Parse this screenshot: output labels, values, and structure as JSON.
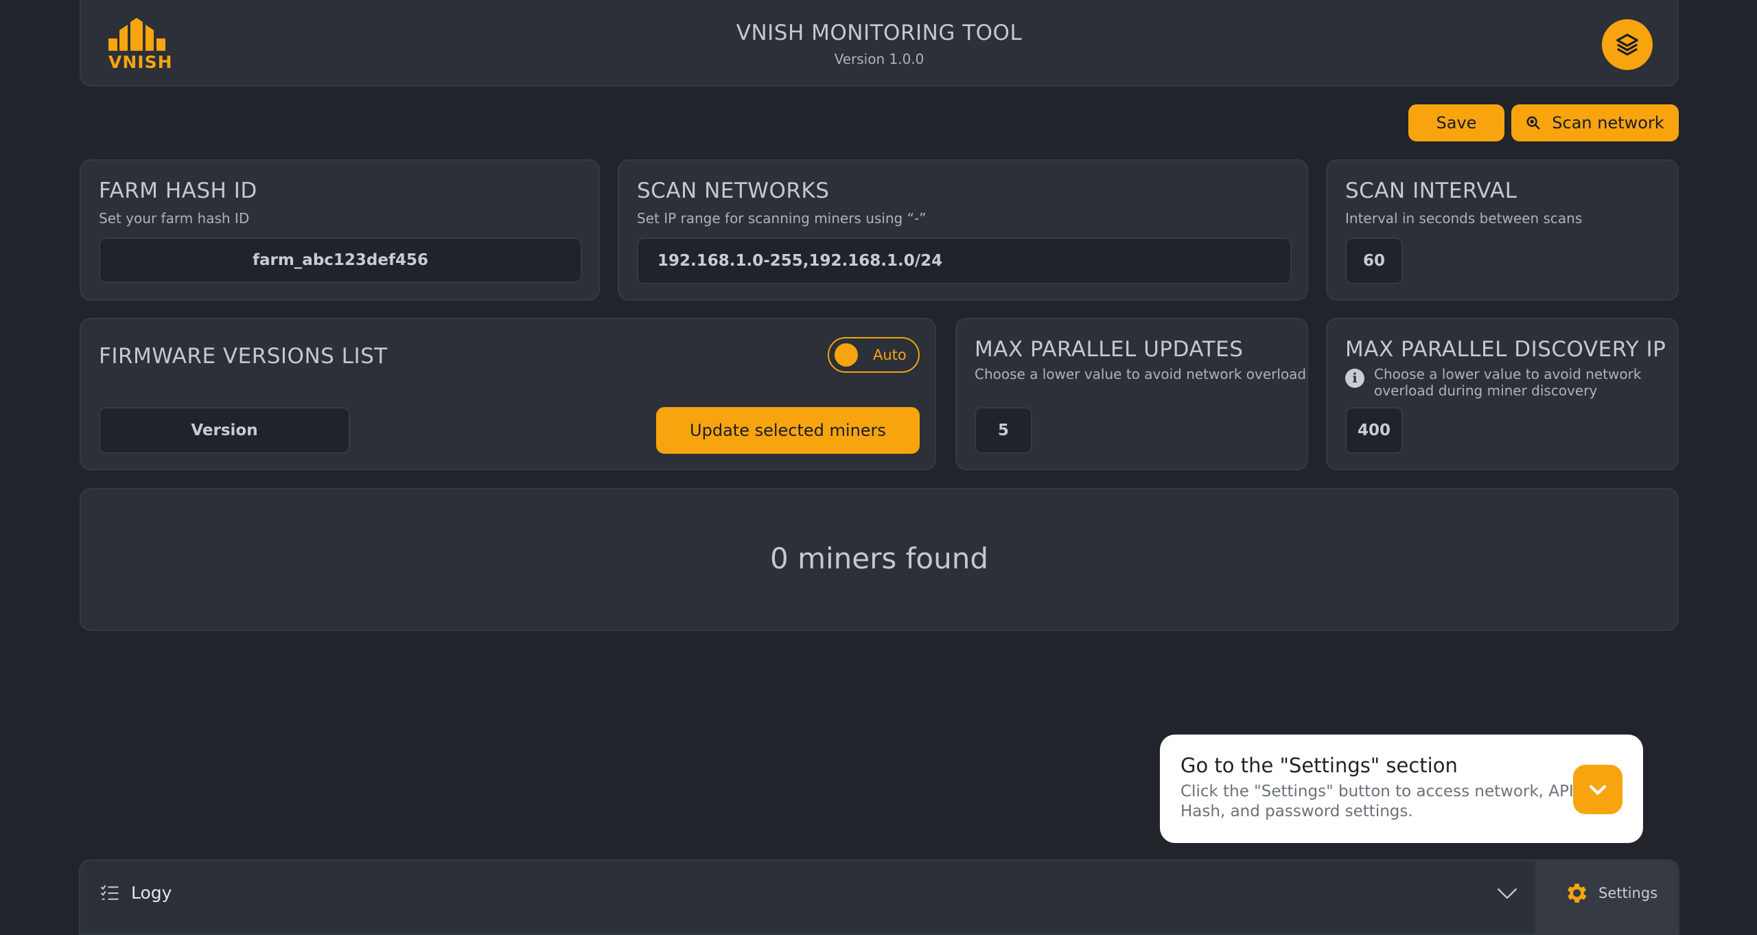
{
  "header": {
    "logo_text": "VNISH",
    "title": "VNISH MONITORING TOOL",
    "version": "Version 1.0.0"
  },
  "toolbar": {
    "save_label": "Save",
    "scan_label": "Scan network"
  },
  "farm_hash": {
    "title": "FARM HASH ID",
    "subtitle": "Set your farm hash ID",
    "value": "farm_abc123def456"
  },
  "scan_networks": {
    "title": "SCAN NETWORKS",
    "subtitle": "Set IP range for scanning miners using “-”",
    "value": "192.168.1.0-255,192.168.1.0/24"
  },
  "scan_interval": {
    "title": "SCAN INTERVAL",
    "subtitle": "Interval in seconds between scans",
    "value": "60"
  },
  "firmware": {
    "title": "FIRMWARE VERSIONS LIST",
    "toggle_label": "Auto",
    "version_placeholder": "Version",
    "update_label": "Update selected miners"
  },
  "max_updates": {
    "title": "MAX PARALLEL UPDATES",
    "subtitle": "Choose a lower value to avoid network overload",
    "value": "5"
  },
  "max_discovery": {
    "title": "MAX PARALLEL DISCOVERY IP",
    "subtitle_line1": "Choose a lower value to avoid network",
    "subtitle_line2": "overload during miner discovery",
    "value": "400"
  },
  "miners": {
    "status": "0 miners found"
  },
  "tooltip": {
    "title": "Go to the \"Settings\" section",
    "body_line1": "Click the \"Settings\" button to access network, API,",
    "body_line2": "Hash, and password settings."
  },
  "footer": {
    "logs_label": "Logy",
    "settings_label": "Settings"
  },
  "colors": {
    "accent": "#f7a40f",
    "background": "#21242a",
    "card": "#2b3039"
  }
}
